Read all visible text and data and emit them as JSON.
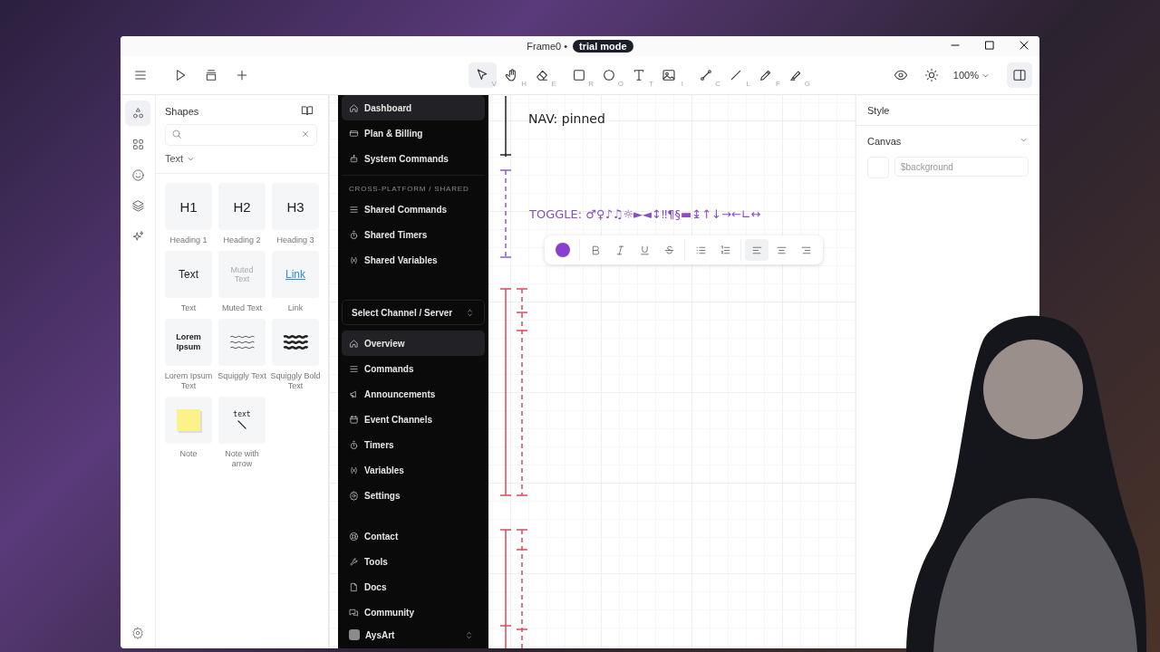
{
  "window": {
    "title": "Frame0 •",
    "badge": "trial mode"
  },
  "toolbar": {
    "tools": [
      {
        "shortcut": "V",
        "selected": true
      },
      {
        "shortcut": "H",
        "selected": false
      },
      {
        "shortcut": "E",
        "selected": false
      },
      {
        "shortcut": "R",
        "selected": false
      },
      {
        "shortcut": "O",
        "selected": false
      },
      {
        "shortcut": "T",
        "selected": false
      },
      {
        "shortcut": "I",
        "selected": false
      },
      {
        "shortcut": "C",
        "selected": false
      },
      {
        "shortcut": "L",
        "selected": false
      },
      {
        "shortcut": "F",
        "selected": false
      },
      {
        "shortcut": "G",
        "selected": false
      }
    ],
    "zoom": "100%",
    "panel_toggle": {
      "selected": true
    }
  },
  "rail": [
    {
      "selected": true
    },
    {
      "selected": false
    },
    {
      "selected": false
    },
    {
      "selected": false
    },
    {
      "selected": false
    }
  ],
  "shapes_panel": {
    "title": "Shapes",
    "filter": "Text",
    "tiles": [
      {
        "kind": "heading",
        "preview": "H1",
        "label": "Heading 1"
      },
      {
        "kind": "heading",
        "preview": "H2",
        "label": "Heading 2"
      },
      {
        "kind": "heading",
        "preview": "H3",
        "label": "Heading 3"
      },
      {
        "kind": "text",
        "preview": "Text",
        "label": "Text"
      },
      {
        "kind": "muted",
        "preview": "Muted Text",
        "label": "Muted Text"
      },
      {
        "kind": "link",
        "preview": "Link",
        "label": "Link"
      },
      {
        "kind": "lorem",
        "preview": "Lorem Ipsum",
        "label": "Lorem Ipsum Text"
      },
      {
        "kind": "squiggly",
        "label": "Squiggly Text"
      },
      {
        "kind": "squiggly_bold",
        "label": "Squiggly Bold Text"
      },
      {
        "kind": "note",
        "label": "Note"
      },
      {
        "kind": "note_arrow",
        "preview": "text",
        "label": "Note with arrow"
      }
    ]
  },
  "canvas": {
    "labels": [
      {
        "kind": "plain",
        "text": "NAV: pinned"
      },
      {
        "kind": "accent",
        "text": "TOGGLE: ♂♀♪♫☼►◄↕‼¶§▬↨↑↓→←∟↔"
      }
    ],
    "text_toolbar": {
      "format": [
        {
          "selected": false
        },
        {
          "selected": false
        },
        {
          "selected": false
        },
        {
          "selected": false
        }
      ],
      "lists": [
        {
          "selected": false
        },
        {
          "selected": false
        }
      ],
      "align": [
        {
          "selected": true
        },
        {
          "selected": false
        },
        {
          "selected": false
        }
      ]
    },
    "nav_mockup": {
      "top_items": [
        {
          "label": "Dashboard",
          "selected": true
        },
        {
          "label": "Plan & Billing",
          "selected": false
        },
        {
          "label": "System Commands",
          "selected": false
        }
      ],
      "section_title": "CROSS-PLATFORM / SHARED",
      "shared_items": [
        {
          "label": "Shared Commands",
          "selected": false
        },
        {
          "label": "Shared Timers",
          "selected": false
        },
        {
          "label": "Shared Variables",
          "selected": false
        }
      ],
      "channel_select": "Select Channel / Server",
      "channel_items": [
        {
          "label": "Overview",
          "selected": true
        },
        {
          "label": "Commands",
          "selected": false
        },
        {
          "label": "Announcements",
          "selected": false
        },
        {
          "label": "Event Channels",
          "selected": false
        },
        {
          "label": "Timers",
          "selected": false
        },
        {
          "label": "Variables",
          "selected": false
        },
        {
          "label": "Settings",
          "selected": false
        }
      ],
      "footer_items": [
        {
          "label": "Contact",
          "selected": false
        },
        {
          "label": "Tools",
          "selected": false
        },
        {
          "label": "Docs",
          "selected": false
        },
        {
          "label": "Community",
          "selected": false
        }
      ],
      "user": "AysArt"
    }
  },
  "style_panel": {
    "title": "Style",
    "section": {
      "title": "Canvas",
      "expanded": true,
      "placeholder": "$background"
    }
  }
}
